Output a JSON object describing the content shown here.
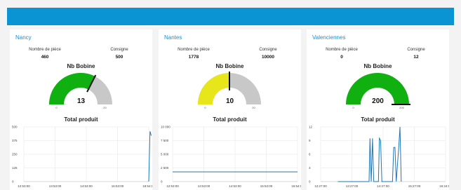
{
  "panels": [
    {
      "city": "Nancy",
      "piece_label": "Nombre de pièce",
      "piece_value": "460",
      "consigne_label": "Consigne",
      "consigne_value": "500",
      "gauge": {
        "title": "Nb Bobine",
        "value": "13",
        "value_num": 13,
        "max": 20,
        "fill_color": "#10b010",
        "min_label": "0",
        "max_label": "20"
      },
      "chart_title": "Total produit",
      "chart_data": {
        "type": "line",
        "title": "Total produit",
        "ylim": [
          0,
          500
        ],
        "yticks": [
          "500",
          "375",
          "250",
          "125",
          "0"
        ],
        "xticks": [
          "12:53:00",
          "13:53:00",
          "14:53:00",
          "16:53:00",
          "18:54:00"
        ],
        "series": [
          {
            "x": [
              4.0,
              4.04,
              4.08
            ],
            "values": [
              0,
              460,
              420
            ]
          }
        ]
      }
    },
    {
      "city": "Nantes",
      "piece_label": "Nombre de pièce",
      "piece_value": "1778",
      "consigne_label": "Consigne",
      "consigne_value": "10000",
      "gauge": {
        "title": "Nb Bobine",
        "value": "10",
        "value_num": 10,
        "max": 20,
        "fill_color": "#e6e61a",
        "min_label": "0",
        "max_label": "20"
      },
      "chart_title": "Total produit",
      "chart_data": {
        "type": "line",
        "title": "Total produit",
        "ylim": [
          0,
          10000
        ],
        "yticks": [
          "10 000",
          "7 500",
          "5 000",
          "2 500",
          "0"
        ],
        "xticks": [
          "12:53:00",
          "13:53:00",
          "14:53:00",
          "15:53:00",
          "16:54:00"
        ],
        "series": [
          {
            "x": [
              0,
              4.0
            ],
            "values": [
              1778,
              1778
            ]
          }
        ]
      }
    },
    {
      "city": "Valenciennes",
      "piece_label": "Nombre de pièce",
      "piece_value": "0",
      "consigne_label": "Consigne",
      "consigne_value": "12",
      "gauge": {
        "title": "Nb Bobine",
        "value": "200",
        "value_num": 200,
        "max": 200,
        "fill_color": "#10b010",
        "min_label": "0",
        "max_label": "200"
      },
      "chart_title": "Total produit",
      "chart_data": {
        "type": "line",
        "title": "Total produit",
        "ylim": [
          0,
          12
        ],
        "yticks": [
          "12",
          "9",
          "6",
          "3",
          "0"
        ],
        "xticks": [
          "12:27:00",
          "13:27:00",
          "14:27:00",
          "15:27:00",
          "16:24:00"
        ],
        "series": [
          {
            "x": [
              0.55,
              1.55,
              1.58,
              1.62,
              1.66,
              1.7,
              1.85,
              1.88,
              1.92,
              1.96,
              2.3,
              2.34,
              2.38,
              2.42,
              2.5,
              2.54,
              2.58
            ],
            "values": [
              0,
              0,
              9.5,
              0,
              9.5,
              0,
              0,
              9.5,
              9,
              0,
              0,
              7.5,
              7.5,
              0,
              7.5,
              12,
              0
            ]
          }
        ]
      }
    }
  ]
}
